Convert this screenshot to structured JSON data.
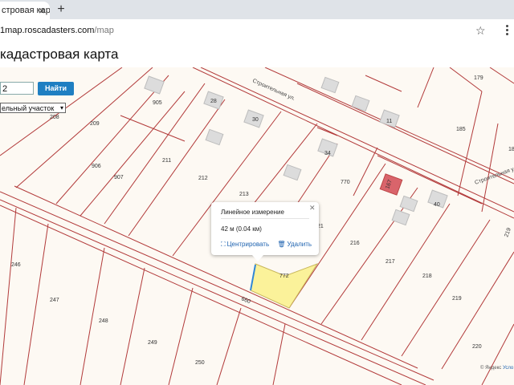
{
  "browser": {
    "tab_title": "стровая карта",
    "new_tab_icon": "plus-icon",
    "url_host": "1map.roscadasters.com",
    "url_path": "/map",
    "bookmark_icon": "star-icon",
    "menu_icon": "kebab-menu-icon"
  },
  "page": {
    "title": "кадастровая карта"
  },
  "search": {
    "value": "2",
    "button_label": "Найти",
    "type_value": "ельный участок"
  },
  "map": {
    "plot_numbers": {
      "p905": "905",
      "p28": "28",
      "p30": "30",
      "p208": "208",
      "p209": "209",
      "p906": "906",
      "p907": "907",
      "p211": "211",
      "p212": "212",
      "p213": "213",
      "p34": "34",
      "p770": "770",
      "p11": "11",
      "p179": "179",
      "p185": "185",
      "p18": "18",
      "p40": "40",
      "p216": "216",
      "p217": "217",
      "p218": "218",
      "p219": "219",
      "p21": "21",
      "p220": "220",
      "p246": "246",
      "p247": "247",
      "p248": "248",
      "p249": "249",
      "p250": "250",
      "p772": "772",
      "p660": "660",
      "p_tilt": "219",
      "p_red": "167"
    },
    "streets": {
      "s1": "Строительная ул.",
      "s2": "Строительная ул."
    },
    "attribution": "© Яндекс",
    "attribution_link": "Усло"
  },
  "measurement_popup": {
    "title": "Линейное измерение",
    "value": "42 м (0.04 км)",
    "center_label": "Центрировать",
    "delete_label": "Удалить",
    "close_icon": "close-icon",
    "center_icon": "center-icon",
    "delete_icon": "trash-icon"
  },
  "colors": {
    "plot_border": "#b23a3a",
    "selected_plot_fill": "#fbf29a",
    "search_button": "#1f7fc2",
    "building": "#dcdcdc",
    "red_building": "#d9646b"
  }
}
